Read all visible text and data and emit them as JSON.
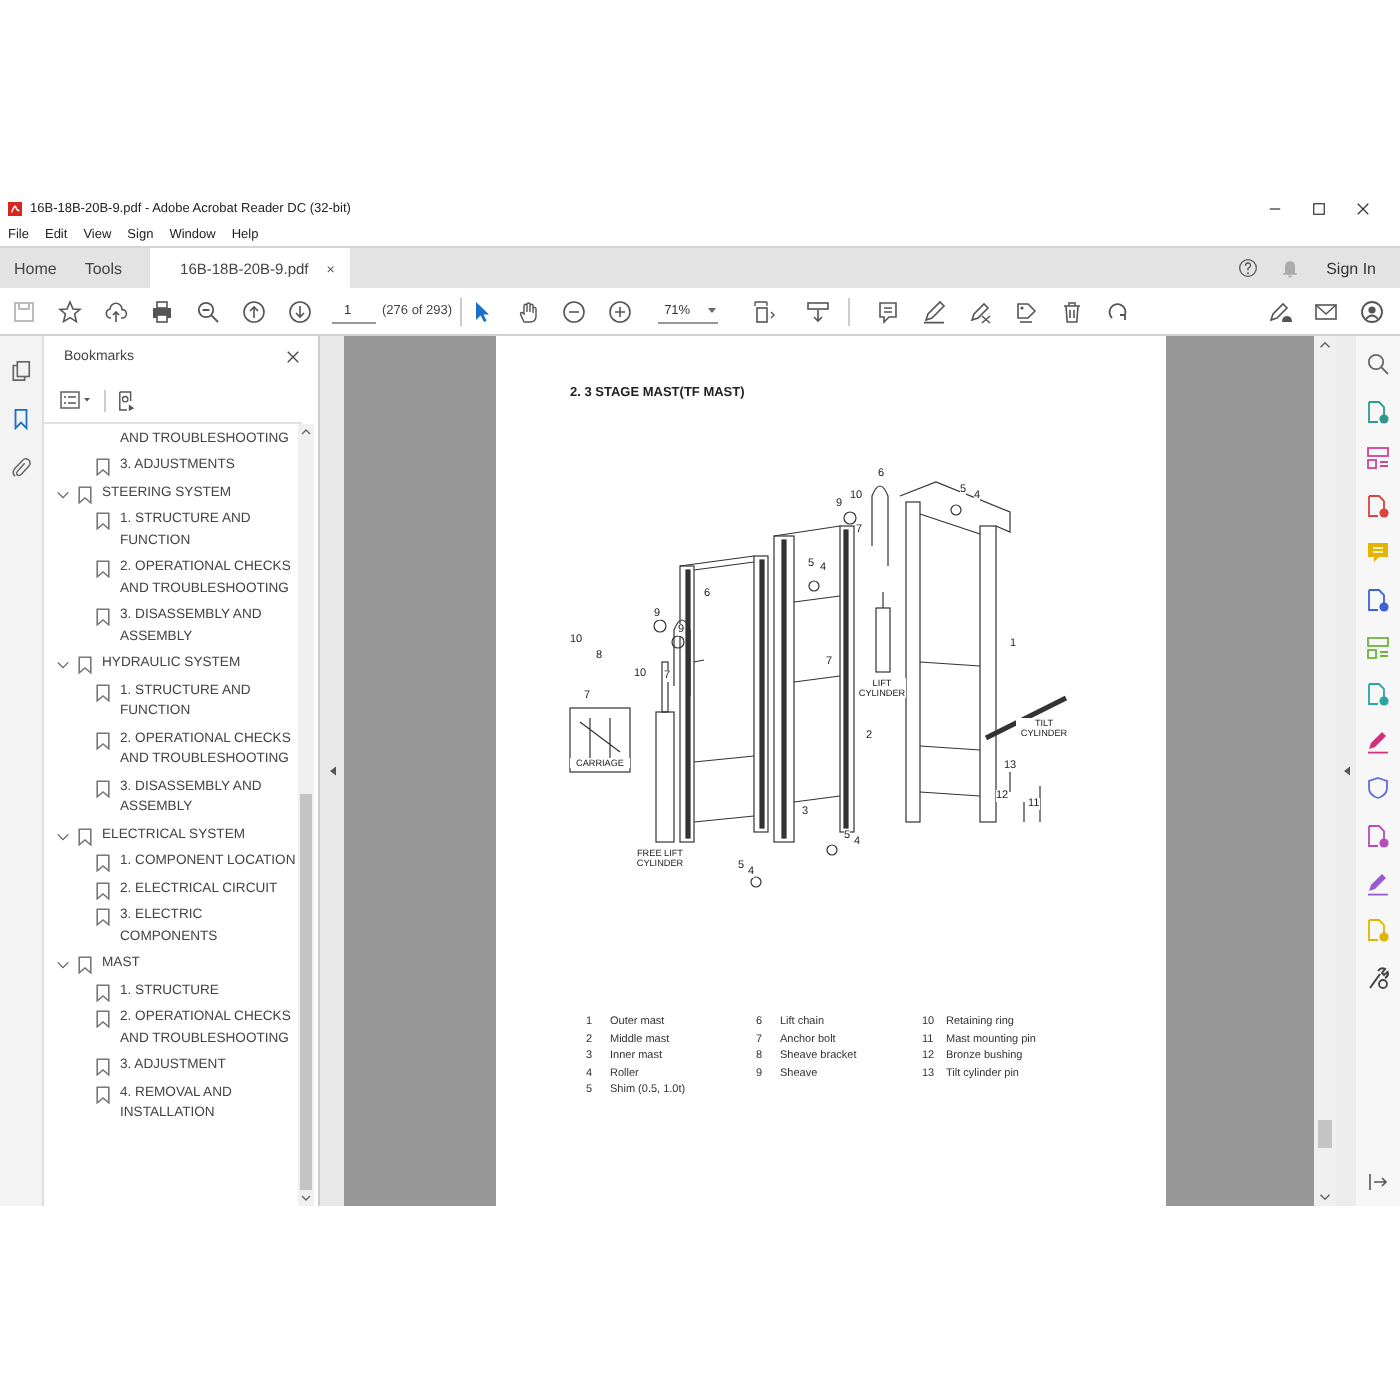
{
  "window": {
    "title": "16B-18B-20B-9.pdf - Adobe Acrobat Reader DC (32-bit)"
  },
  "menu": [
    "File",
    "Edit",
    "View",
    "Sign",
    "Window",
    "Help"
  ],
  "tabs": [
    {
      "label": "Home",
      "kind": "nav",
      "selected": false
    },
    {
      "label": "Tools",
      "kind": "nav",
      "selected": false
    },
    {
      "label": "16B-18B-20B-9.pdf",
      "kind": "document",
      "selected": true,
      "close": "×"
    }
  ],
  "account": {
    "sign_in": "Sign In"
  },
  "toolbar": {
    "page_number": "1",
    "page_count": "(276 of 293)",
    "zoom": "71%"
  },
  "side_panels": [
    {
      "kind": "pages",
      "selected": false
    },
    {
      "kind": "bookmarks",
      "selected": true
    },
    {
      "kind": "attachments",
      "selected": false
    }
  ],
  "bookmarks": {
    "title": "Bookmarks",
    "continued_items": [
      {
        "label": "AND TROUBLESHOOTING",
        "kind": "continuation"
      },
      {
        "label": "3. ADJUSTMENTS",
        "kind": "bookmark"
      }
    ],
    "sections": [
      {
        "label": "STEERING SYSTEM",
        "expanded": true,
        "children": [
          {
            "label": "1. STRUCTURE AND FUNCTION"
          },
          {
            "label": "2. OPERATIONAL CHECKS AND TROUBLESHOOTING"
          },
          {
            "label": "3. DISASSEMBLY AND ASSEMBLY"
          }
        ]
      },
      {
        "label": "HYDRAULIC SYSTEM",
        "expanded": true,
        "children": [
          {
            "label": "1. STRUCTURE AND FUNCTION"
          },
          {
            "label": "2. OPERATIONAL CHECKS AND TROUBLESHOOTING"
          },
          {
            "label": "3. DISASSEMBLY AND ASSEMBLY"
          }
        ]
      },
      {
        "label": "ELECTRICAL SYSTEM",
        "expanded": true,
        "children": [
          {
            "label": "1. COMPONENT LOCATION"
          },
          {
            "label": "2. ELECTRICAL CIRCUIT"
          },
          {
            "label": "3. ELECTRIC COMPONENTS"
          }
        ]
      },
      {
        "label": "MAST",
        "expanded": true,
        "children": [
          {
            "label": "1. STRUCTURE"
          },
          {
            "label": "2. OPERATIONAL CHECKS AND TROUBLESHOOTING"
          },
          {
            "label": "3. ADJUSTMENT"
          },
          {
            "label": "4. REMOVAL AND INSTALLATION"
          }
        ]
      }
    ]
  },
  "document": {
    "heading": "2. 3 STAGE MAST(TF MAST)",
    "callouts": [
      "6",
      "9",
      "10",
      "7",
      "5",
      "4",
      "5",
      "4",
      "6",
      "9",
      "9",
      "10",
      "8",
      "10",
      "7",
      "7",
      "7",
      "1",
      "2",
      "13",
      "3",
      "12",
      "11",
      "5",
      "4",
      "5",
      "4"
    ],
    "part_labels": [
      "LIFT CYLINDER",
      "TILT CYLINDER",
      "CARRIAGE",
      "FREE LIFT CYLINDER"
    ],
    "legend_columns": [
      [
        {
          "number": "1",
          "name": "Outer mast"
        },
        {
          "number": "2",
          "name": "Middle mast"
        },
        {
          "number": "3",
          "name": "Inner mast"
        },
        {
          "number": "4",
          "name": "Roller"
        },
        {
          "number": "5",
          "name": "Shim (0.5, 1.0t)"
        }
      ],
      [
        {
          "number": "6",
          "name": "Lift chain"
        },
        {
          "number": "7",
          "name": "Anchor bolt"
        },
        {
          "number": "8",
          "name": "Sheave bracket"
        },
        {
          "number": "9",
          "name": "Sheave"
        }
      ],
      [
        {
          "number": "10",
          "name": "Retaining ring"
        },
        {
          "number": "11",
          "name": "Mast mounting pin"
        },
        {
          "number": "12",
          "name": "Bronze bushing"
        },
        {
          "number": "13",
          "name": "Tilt cylinder pin"
        }
      ]
    ]
  }
}
